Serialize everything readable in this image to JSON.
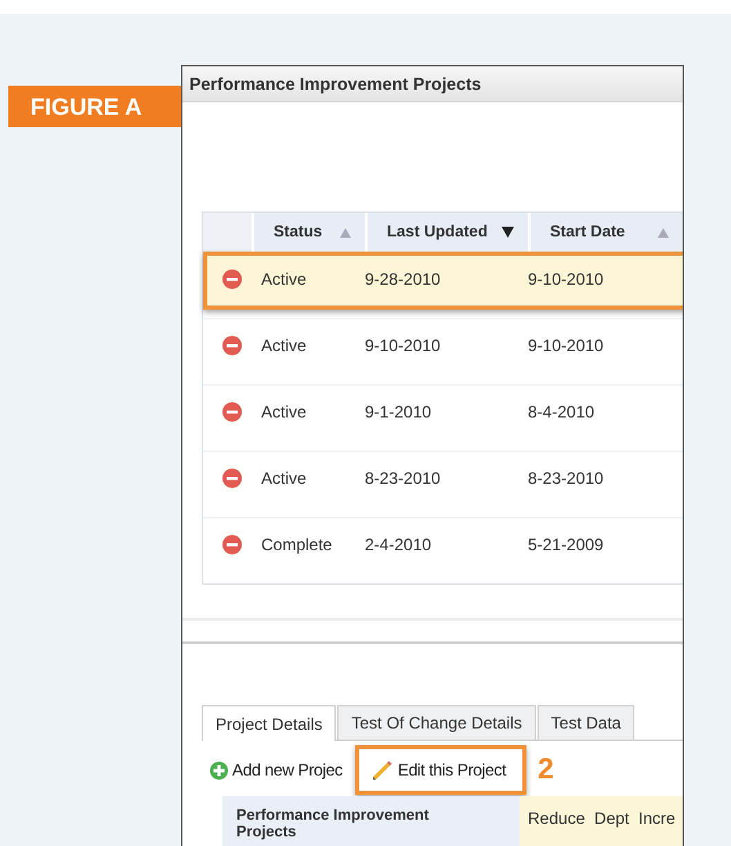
{
  "figure_label": "FIGURE A",
  "window": {
    "title": "Performance Improvement Projects"
  },
  "table": {
    "columns": [
      {
        "label": "Status",
        "sort_descending": false
      },
      {
        "label": "Last Updated",
        "sort_descending": true
      },
      {
        "label": "Start Date",
        "sort_descending": false
      }
    ],
    "rows": [
      {
        "cells": [
          "Active",
          "9-28-2010",
          "9-10-2010"
        ],
        "selected": true
      },
      {
        "cells": [
          "Active",
          "9-10-2010",
          "9-10-2010"
        ],
        "selected": false
      },
      {
        "cells": [
          "Active",
          "9-1-2010",
          "8-4-2010"
        ],
        "selected": false
      },
      {
        "cells": [
          "Active",
          "8-23-2010",
          "8-23-2010"
        ],
        "selected": false
      },
      {
        "cells": [
          "Complete",
          "2-4-2010",
          "5-21-2009"
        ],
        "selected": false
      }
    ]
  },
  "tabs": [
    {
      "label": "Project Details",
      "selected": true
    },
    {
      "label": "Test Of Change Details",
      "selected": false
    },
    {
      "label": "Test Data",
      "selected": false
    }
  ],
  "toolbar": [
    {
      "kind": "add",
      "label": "Add new Projec",
      "highlighted": false
    },
    {
      "kind": "edit",
      "label": "Edit this Project",
      "highlighted": true
    }
  ],
  "callout": "2",
  "details": [
    {
      "label": "Performance Improvement Projects",
      "value": "Reduce  Dept  Incre"
    }
  ]
}
